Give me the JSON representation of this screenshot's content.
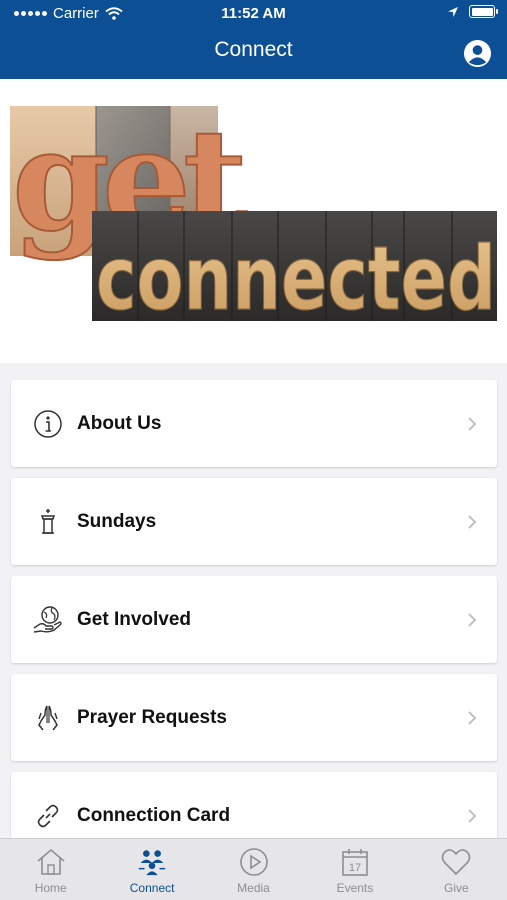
{
  "status_bar": {
    "carrier": "Carrier",
    "time": "11:52 AM"
  },
  "nav": {
    "title": "Connect"
  },
  "hero": {
    "line1": "get",
    "line2": "connected"
  },
  "menu": {
    "items": [
      {
        "label": "About Us",
        "icon": "info-icon"
      },
      {
        "label": "Sundays",
        "icon": "pulpit-icon"
      },
      {
        "label": "Get Involved",
        "icon": "globe-hand-icon"
      },
      {
        "label": "Prayer Requests",
        "icon": "praying-hands-icon"
      },
      {
        "label": "Connection Card",
        "icon": "link-icon"
      }
    ]
  },
  "tabs": [
    {
      "label": "Home",
      "icon": "home-icon",
      "active": false
    },
    {
      "label": "Connect",
      "icon": "people-icon",
      "active": true
    },
    {
      "label": "Media",
      "icon": "play-icon",
      "active": false
    },
    {
      "label": "Events",
      "icon": "calendar-icon",
      "active": false,
      "calendar_day": "17"
    },
    {
      "label": "Give",
      "icon": "heart-icon",
      "active": false
    }
  ],
  "colors": {
    "accent": "#0d4f94",
    "inactive": "#8e8e93",
    "background": "#f2f2f4"
  }
}
